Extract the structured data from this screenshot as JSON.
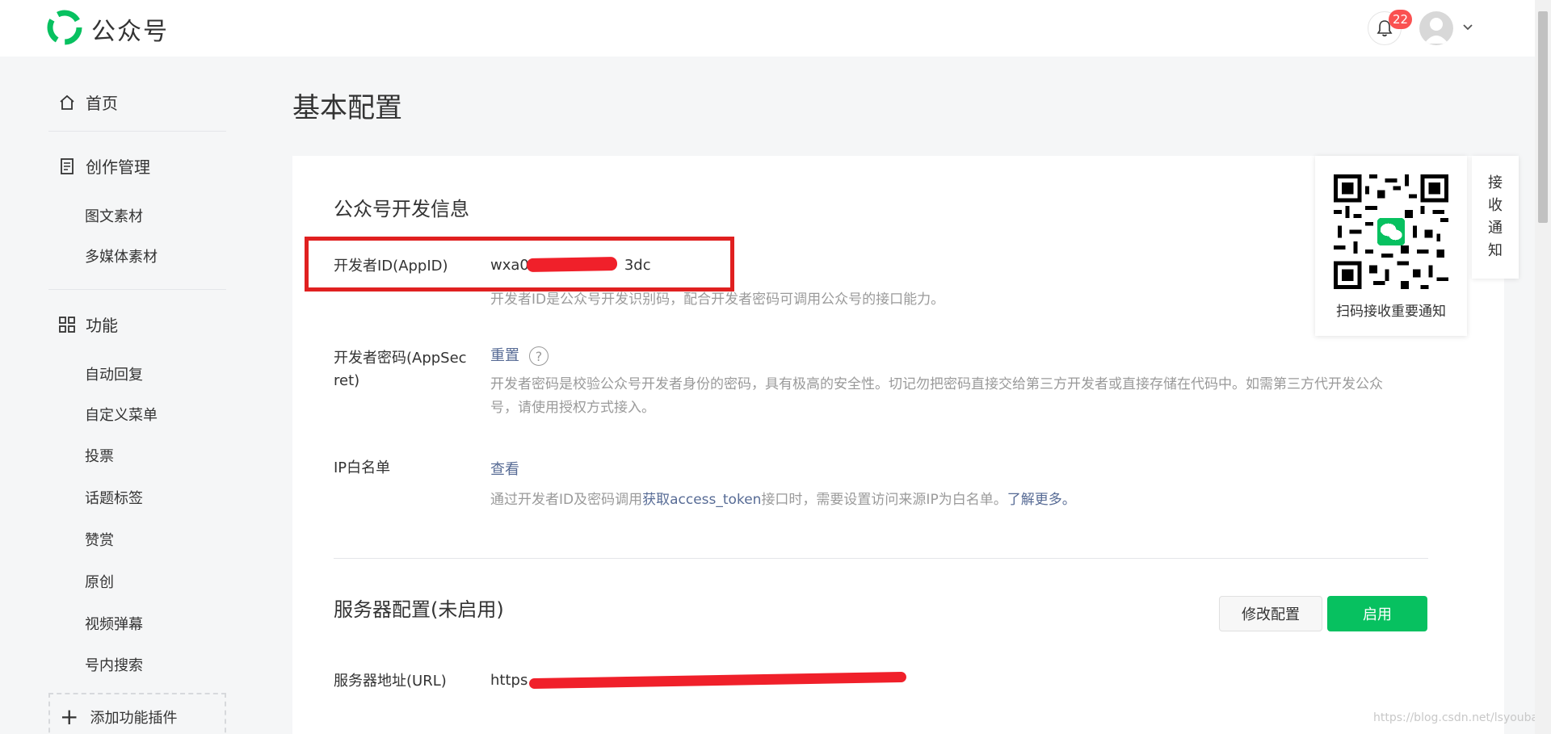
{
  "header": {
    "brand": "公众号",
    "notification_count": "22",
    "accent": "#07c160"
  },
  "sidebar": {
    "home": "首页",
    "creation": {
      "label": "创作管理",
      "items": [
        "图文素材",
        "多媒体素材"
      ]
    },
    "features": {
      "label": "功能",
      "items": [
        "自动回复",
        "自定义菜单",
        "投票",
        "话题标签",
        "赞赏",
        "原创",
        "视频弹幕",
        "号内搜索"
      ]
    },
    "add_plugin": "添加功能插件"
  },
  "page": {
    "title": "基本配置"
  },
  "dev_info": {
    "title": "公众号开发信息",
    "appid": {
      "label": "开发者ID(AppID)",
      "value": "wxa0",
      "value_tail": "3dc",
      "desc": "开发者ID是公众号开发识别码，配合开发者密码可调用公众号的接口能力。"
    },
    "appsecret": {
      "label_line1": "开发者密码(AppSec",
      "label_line2": "ret)",
      "action": "重置",
      "help": "?",
      "desc_line1": "开发者密码是校验公众号开发者身份的密码，具有极高的安全性。切记勿把密码直接交给第三方开发者或直接存储在代码中。如需第三方代开发公众",
      "desc_line2": "号，请使用授权方式接入。"
    },
    "ip_whitelist": {
      "label": "IP白名单",
      "action": "查看",
      "desc_pre": "通过开发者ID及密码调用",
      "desc_link1": "获取access_token",
      "desc_mid": "接口时，需要设置访问来源IP为白名单。",
      "desc_link2": "了解更多。"
    }
  },
  "server_config": {
    "title": "服务器配置(未启用)",
    "edit_button": "修改配置",
    "enable_button": "启用",
    "url_label": "服务器地址(URL)",
    "url_value": "https"
  },
  "qr_card": {
    "caption": "扫码接收重要通知"
  },
  "notify_tab": {
    "chars": [
      "接",
      "收",
      "通",
      "知"
    ]
  },
  "watermark": "https://blog.csdn.net/lsyoubao"
}
